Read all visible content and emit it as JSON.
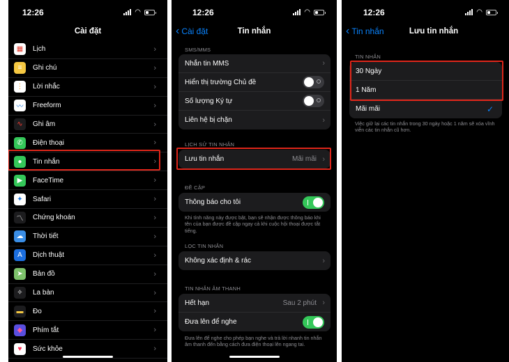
{
  "phone1": {
    "time": "12:26",
    "title": "Cài đặt",
    "items": [
      {
        "label": "Lịch",
        "icon": "calendar-icon",
        "glyph": "▦",
        "color": "#ffffff",
        "fg": "#e33b2e"
      },
      {
        "label": "Ghi chú",
        "icon": "notes-icon",
        "glyph": "≡",
        "color": "#f5c842",
        "fg": "#ffffff"
      },
      {
        "label": "Lời nhắc",
        "icon": "reminders-icon",
        "glyph": "⋮",
        "color": "#ffffff",
        "fg": "#ff9500"
      },
      {
        "label": "Freeform",
        "icon": "freeform-icon",
        "glyph": "〰",
        "color": "#ffffff",
        "fg": "#1f7ae0"
      },
      {
        "label": "Ghi âm",
        "icon": "voice-memos-icon",
        "glyph": "∿",
        "color": "#1c1c1e",
        "fg": "#ff3b30"
      },
      {
        "label": "Điện thoại",
        "icon": "phone-icon",
        "glyph": "✆",
        "color": "#34c759",
        "fg": "#ffffff"
      },
      {
        "label": "Tin nhắn",
        "icon": "messages-icon",
        "glyph": "●",
        "color": "#34c759",
        "fg": "#ffffff"
      },
      {
        "label": "FaceTime",
        "icon": "facetime-icon",
        "glyph": "▶",
        "color": "#34c759",
        "fg": "#ffffff"
      },
      {
        "label": "Safari",
        "icon": "safari-icon",
        "glyph": "✦",
        "color": "#ffffff",
        "fg": "#1f7ae0"
      },
      {
        "label": "Chứng khoán",
        "icon": "stocks-icon",
        "glyph": "〽",
        "color": "#1c1c1e",
        "fg": "#ffffff"
      },
      {
        "label": "Thời tiết",
        "icon": "weather-icon",
        "glyph": "☁",
        "color": "#3a8ee6",
        "fg": "#ffffff"
      },
      {
        "label": "Dịch thuật",
        "icon": "translate-icon",
        "glyph": "A",
        "color": "#1c6fe0",
        "fg": "#ffffff"
      },
      {
        "label": "Bản đồ",
        "icon": "maps-icon",
        "glyph": "➤",
        "color": "#7dc26b",
        "fg": "#ffffff"
      },
      {
        "label": "La bàn",
        "icon": "compass-icon",
        "glyph": "✧",
        "color": "#1c1c1e",
        "fg": "#ffffff"
      },
      {
        "label": "Đo",
        "icon": "measure-icon",
        "glyph": "▬",
        "color": "#1c1c1e",
        "fg": "#f5c842"
      },
      {
        "label": "Phím tắt",
        "icon": "shortcuts-icon",
        "glyph": "◆",
        "color": "#5a4fe0",
        "fg": "#ff5c9a"
      },
      {
        "label": "Sức khỏe",
        "icon": "health-icon",
        "glyph": "♥",
        "color": "#ffffff",
        "fg": "#ff2d55"
      }
    ]
  },
  "phone2": {
    "time": "12:26",
    "back": "Cài đặt",
    "title": "Tin nhắn",
    "sec_sms": "SMS/MMS",
    "sms_rows": [
      "Nhắn tin MMS",
      "Hiển thị trường Chủ đề",
      "Số lượng Ký tự",
      "Liên hệ bị chặn"
    ],
    "sec_history": "LỊCH SỬ TIN NHẮN",
    "keep_label": "Lưu tin nhắn",
    "keep_value": "Mãi mãi",
    "sec_mention": "ĐỀ CẬP",
    "notify_me": "Thông báo cho tôi",
    "mention_note": "Khi tính năng này được bật, bạn sẽ nhận được thông báo khi tên của bạn được đề cập ngay cả khi cuộc hội thoại được tắt tiếng.",
    "sec_filter": "LỌC TIN NHẮN",
    "unknown_spam": "Không xác định & rác",
    "sec_audio": "TIN NHẮN ÂM THANH",
    "expire_label": "Hết hạn",
    "expire_value": "Sau 2 phút",
    "raise_listen": "Đưa lên để nghe",
    "audio_note": "Đưa lên để nghe cho phép bạn nghe và trả lời nhanh tin nhắn âm thanh đến bằng cách đưa điện thoại lên ngang tai."
  },
  "phone3": {
    "time": "12:26",
    "back": "Tin nhắn",
    "title": "Lưu tin nhắn",
    "sec": "TIN NHẮN",
    "opt1": "30 Ngày",
    "opt2": "1 Năm",
    "opt3": "Mãi mãi",
    "note": "Việc giữ lại các tin nhắn trong 30 ngày hoặc 1 năm sẽ xóa vĩnh viễn các tin nhắn cũ hơn."
  },
  "colors": {
    "highlight": "#e0261a",
    "accent": "#0a84ff",
    "toggle_on": "#34c759"
  }
}
